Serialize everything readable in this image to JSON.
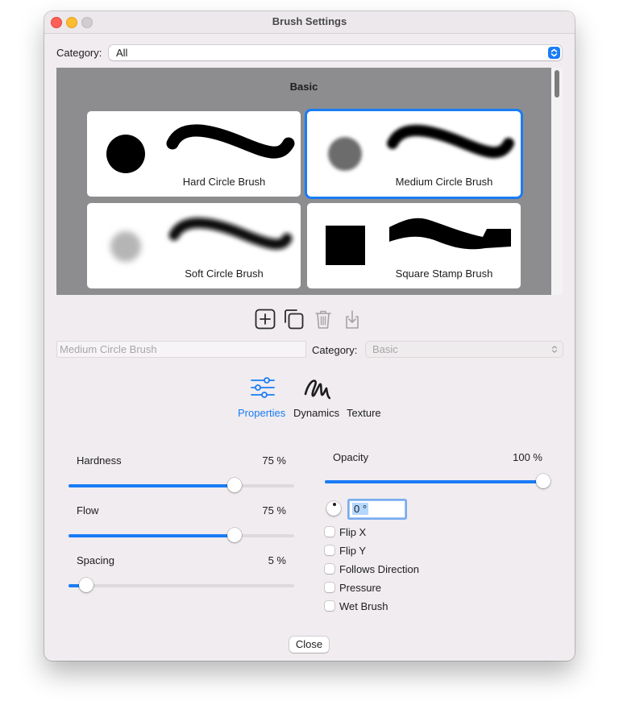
{
  "window": {
    "title": "Brush Settings"
  },
  "category": {
    "label": "Category:",
    "value": "All"
  },
  "brush_grid": {
    "section_title": "Basic",
    "brushes": [
      {
        "name": "Hard Circle Brush",
        "selected": false
      },
      {
        "name": "Medium Circle Brush",
        "selected": true
      },
      {
        "name": "Soft Circle Brush",
        "selected": false
      },
      {
        "name": "Square Stamp Brush",
        "selected": false
      }
    ]
  },
  "toolbar": {
    "icons": [
      "add-brush-icon",
      "duplicate-brush-icon",
      "delete-brush-icon",
      "import-brush-icon"
    ]
  },
  "brush_editor": {
    "name_value": "Medium Circle Brush",
    "category_label": "Category:",
    "category_value": "Basic"
  },
  "tabs": [
    {
      "label": "Properties",
      "icon": "sliders-icon",
      "active": true
    },
    {
      "label": "Dynamics",
      "icon": "squiggle-icon",
      "active": false
    },
    {
      "label": "Texture",
      "icon": "",
      "active": false
    }
  ],
  "properties": {
    "hardness": {
      "label": "Hardness",
      "value_text": "75 %",
      "fraction": 0.75
    },
    "flow": {
      "label": "Flow",
      "value_text": "75 %",
      "fraction": 0.75
    },
    "spacing": {
      "label": "Spacing",
      "value_text": "5 %",
      "fraction": 0.05
    },
    "opacity": {
      "label": "Opacity",
      "value_text": "100 %",
      "fraction": 1.0
    },
    "angle": {
      "value": "0 °"
    },
    "checkboxes": [
      {
        "label": "Flip X",
        "checked": false
      },
      {
        "label": "Flip Y",
        "checked": false
      },
      {
        "label": "Follows Direction",
        "checked": false
      },
      {
        "label": "Pressure",
        "checked": false
      },
      {
        "label": "Wet Brush",
        "checked": false
      }
    ]
  },
  "footer": {
    "close_label": "Close"
  },
  "colors": {
    "accent": "#1a7cf5",
    "grid_background": "#8d8d90",
    "window_background": "#f0ecef"
  }
}
